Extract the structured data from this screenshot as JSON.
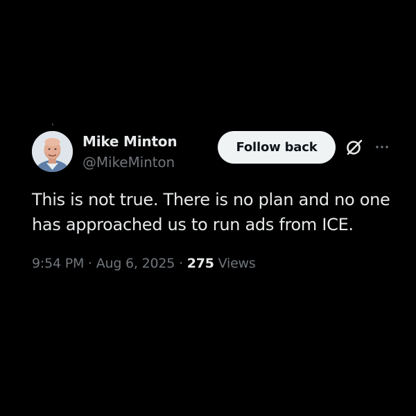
{
  "author": {
    "name": "Mike Minton",
    "handle": "@MikeMinton"
  },
  "follow_button_label": "Follow back",
  "tweet": {
    "text": "This is not true. There is no plan and no one has approached us to run ads from ICE."
  },
  "meta": {
    "time": "9:54 PM",
    "separator": " · ",
    "date": "Aug 6, 2025",
    "views_count": "275",
    "views_label": "Views"
  },
  "icons": {
    "grok": "grok-icon",
    "more": "more-options-icon"
  },
  "colors": {
    "background": "#000000",
    "primary_text": "#e7e9ea",
    "secondary_text": "#71767b",
    "button_bg": "#eff3f4",
    "button_text": "#0f1419"
  }
}
